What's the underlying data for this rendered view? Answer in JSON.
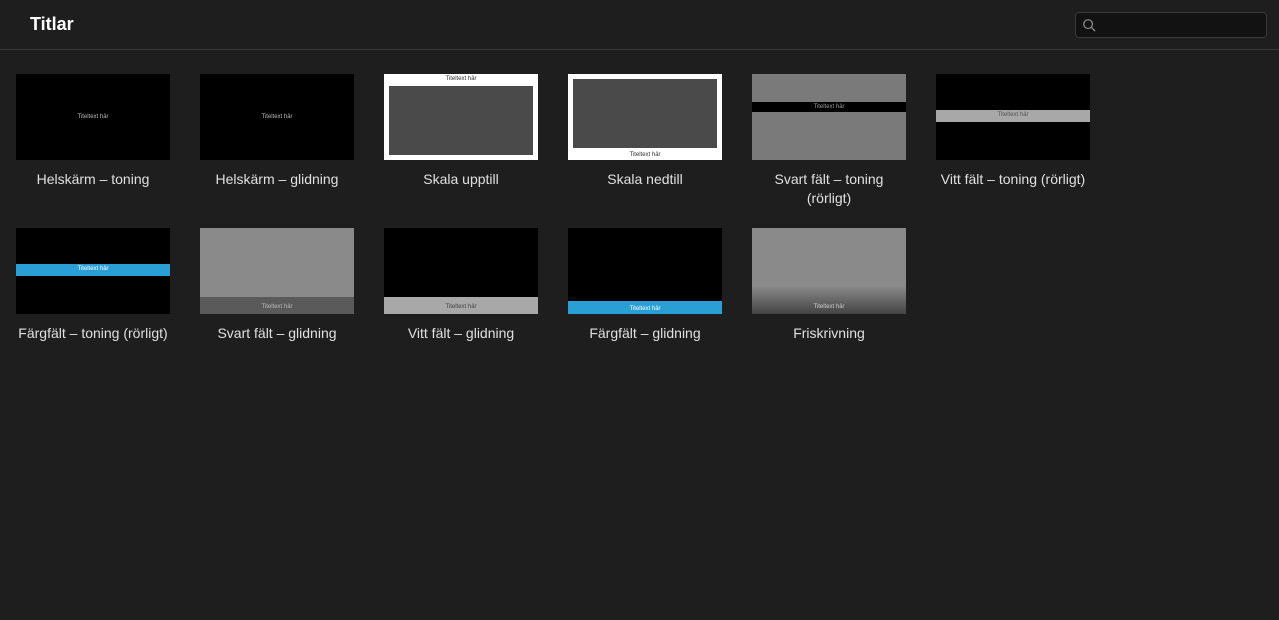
{
  "header": {
    "title": "Titlar",
    "search_placeholder": ""
  },
  "preview_text": "Titeltext här",
  "titles": [
    {
      "id": "helskarm-toning",
      "label": "Helskärm – toning",
      "variant": "full-black-center"
    },
    {
      "id": "helskarm-glidning",
      "label": "Helskärm – glidning",
      "variant": "full-black-center"
    },
    {
      "id": "skala-upptill",
      "label": "Skala upptill",
      "variant": "skala-up"
    },
    {
      "id": "skala-nedtill",
      "label": "Skala nedtill",
      "variant": "skala-down"
    },
    {
      "id": "svart-falt-toning",
      "label": "Svart fält – toning (rörligt)",
      "variant": "svart-ton"
    },
    {
      "id": "vitt-falt-toning",
      "label": "Vitt fält – toning (rörligt)",
      "variant": "vitt-ton"
    },
    {
      "id": "fargfalt-toning",
      "label": "Färgfält – toning (rörligt)",
      "variant": "farg-ton"
    },
    {
      "id": "svart-falt-glidning",
      "label": "Svart fält – glidning",
      "variant": "svart-gl"
    },
    {
      "id": "vitt-falt-glidning",
      "label": "Vitt fält – glidning",
      "variant": "vitt-gl"
    },
    {
      "id": "fargfalt-glidning",
      "label": "Färgfält – glidning",
      "variant": "farg-gl"
    },
    {
      "id": "friskrivning",
      "label": "Friskrivning",
      "variant": "frisk"
    }
  ]
}
